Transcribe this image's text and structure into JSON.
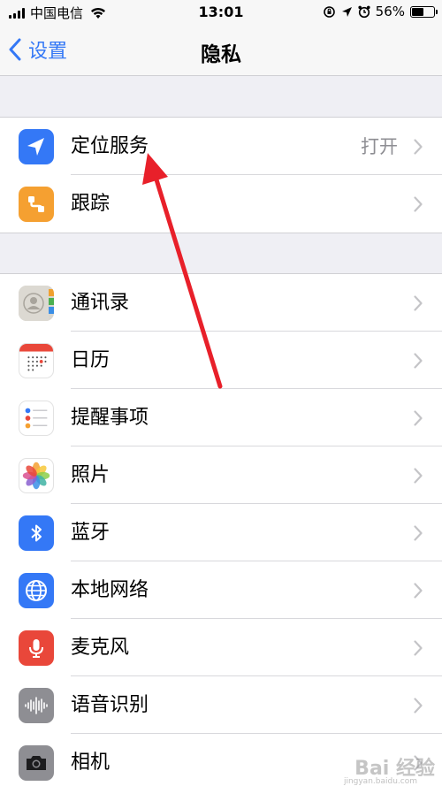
{
  "status_bar": {
    "carrier": "中国电信",
    "time": "13:01",
    "battery_percent": "56%",
    "battery_level": 0.56,
    "icons": [
      "signal-icon",
      "wifi-icon",
      "orientation-lock-icon",
      "location-arrow-icon",
      "alarm-icon",
      "battery-icon"
    ]
  },
  "nav": {
    "back_label": "设置",
    "title": "隐私"
  },
  "groups": [
    {
      "rows": [
        {
          "label": "定位服务",
          "value": "打开",
          "icon": "location-icon",
          "color": "#3478f6"
        },
        {
          "label": "跟踪",
          "icon": "tracking-icon",
          "color": "#f5a031"
        }
      ]
    },
    {
      "rows": [
        {
          "label": "通讯录",
          "icon": "contacts-icon",
          "color": "#d9d6cf"
        },
        {
          "label": "日历",
          "icon": "calendar-icon",
          "color": "#ffffff"
        },
        {
          "label": "提醒事项",
          "icon": "reminders-icon",
          "color": "#ffffff"
        },
        {
          "label": "照片",
          "icon": "photos-icon",
          "color": "#ffffff"
        },
        {
          "label": "蓝牙",
          "icon": "bluetooth-icon",
          "color": "#3478f6"
        },
        {
          "label": "本地网络",
          "icon": "globe-icon",
          "color": "#3478f6"
        },
        {
          "label": "麦克风",
          "icon": "microphone-icon",
          "color": "#e9473a"
        },
        {
          "label": "语音识别",
          "icon": "speech-recognition-icon",
          "color": "#8e8e93"
        },
        {
          "label": "相机",
          "icon": "camera-icon",
          "color": "#8e8e93"
        }
      ]
    }
  ],
  "annotation": {
    "type": "red-arrow",
    "color": "#e8202a",
    "points_to": "定位服务"
  },
  "watermark": {
    "text": "Bai 经验",
    "subtext": "jingyan.baidu.com"
  },
  "colors": {
    "accent": "#3478f6",
    "chevron": "#c4c4c7",
    "secondary_text": "#8e8e93"
  }
}
